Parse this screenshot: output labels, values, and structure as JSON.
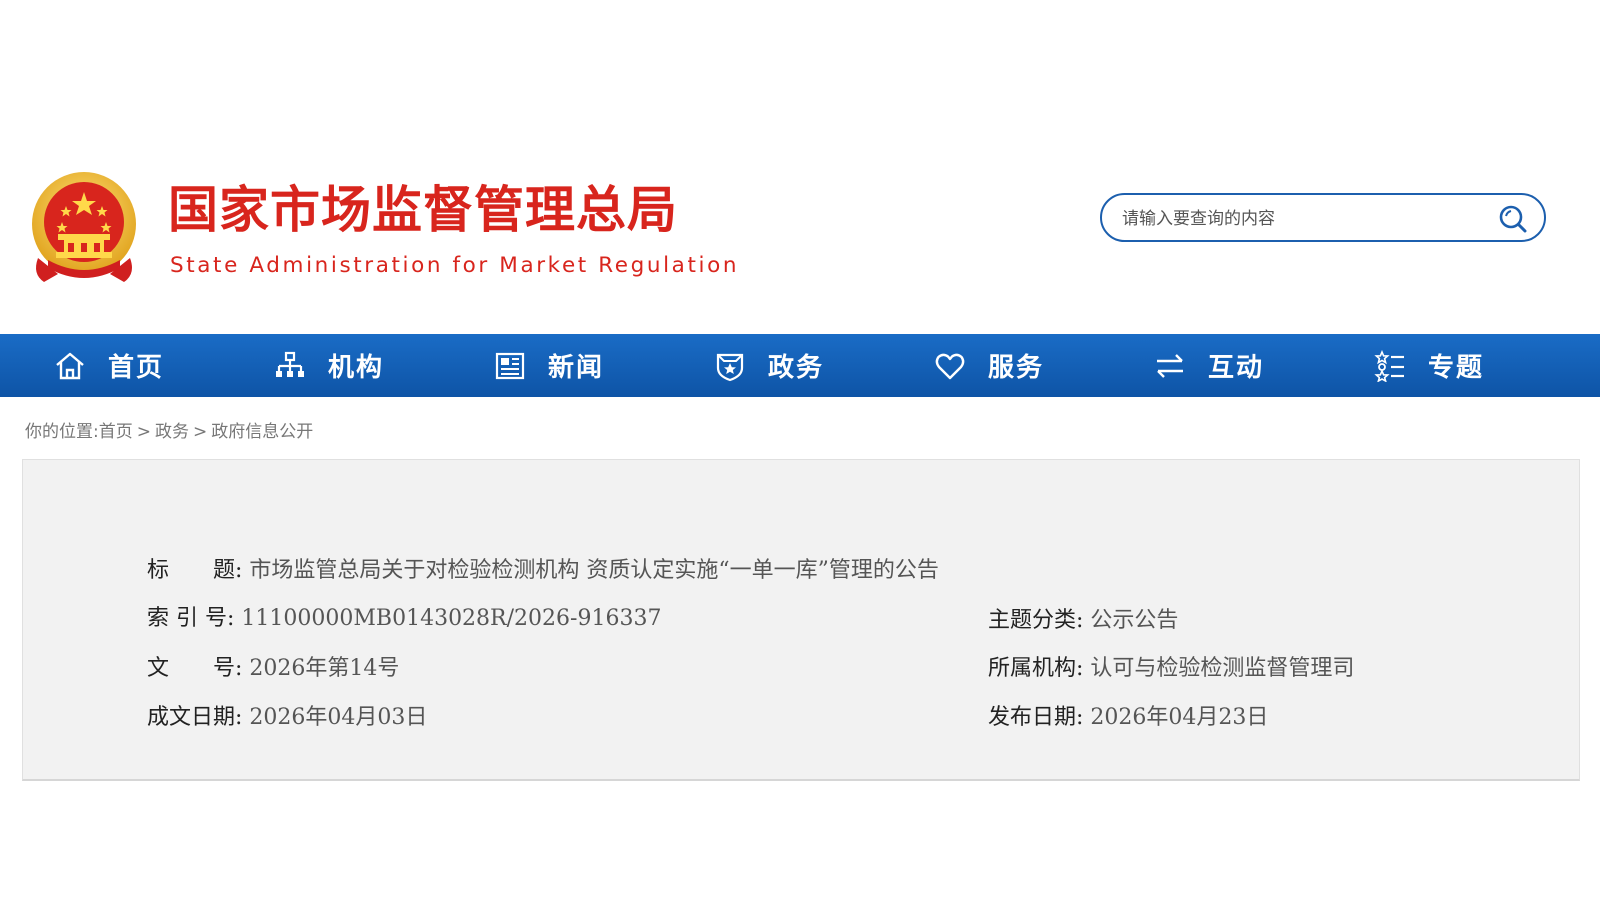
{
  "header": {
    "title_cn": "国家市场监督管理总局",
    "title_en": "State Administration for Market Regulation",
    "emblem_icon": "national-emblem-icon",
    "search": {
      "placeholder": "请输入要查询的内容",
      "value": ""
    },
    "colors": {
      "brand_red": "#d8251d",
      "search_border": "#1c5fae"
    }
  },
  "nav": {
    "items": [
      {
        "label": "首页",
        "icon": "home-icon"
      },
      {
        "label": "机构",
        "icon": "org-chart-icon"
      },
      {
        "label": "新闻",
        "icon": "newspaper-icon"
      },
      {
        "label": "政务",
        "icon": "shield-star-icon"
      },
      {
        "label": "服务",
        "icon": "heart-icon"
      },
      {
        "label": "互动",
        "icon": "exchange-arrows-icon"
      },
      {
        "label": "专题",
        "icon": "star-list-icon"
      }
    ],
    "colors": {
      "background": "#1262b6",
      "text": "#ffffff"
    }
  },
  "breadcrumb": {
    "prefix": "你的位置:",
    "items": [
      "首页",
      "政务",
      "政府信息公开"
    ],
    "separator": ">"
  },
  "document_info": {
    "title_label": "标　　题:",
    "title_value": "市场监管总局关于对检验检测机构 资质认定实施“一单一库”管理的公告",
    "index_label": "索 引 号:",
    "index_value": "11100000MB0143028R/2026-916337",
    "topic_label": "主题分类:",
    "topic_value": "公示公告",
    "doc_no_label": "文　　号:",
    "doc_no_value": "2026年第14号",
    "agency_label": "所属机构:",
    "agency_value": "认可与检验检测监督管理司",
    "written_date_label": "成文日期:",
    "written_date_value": "2026年04月03日",
    "publish_date_label": "发布日期:",
    "publish_date_value": "2026年04月23日"
  }
}
